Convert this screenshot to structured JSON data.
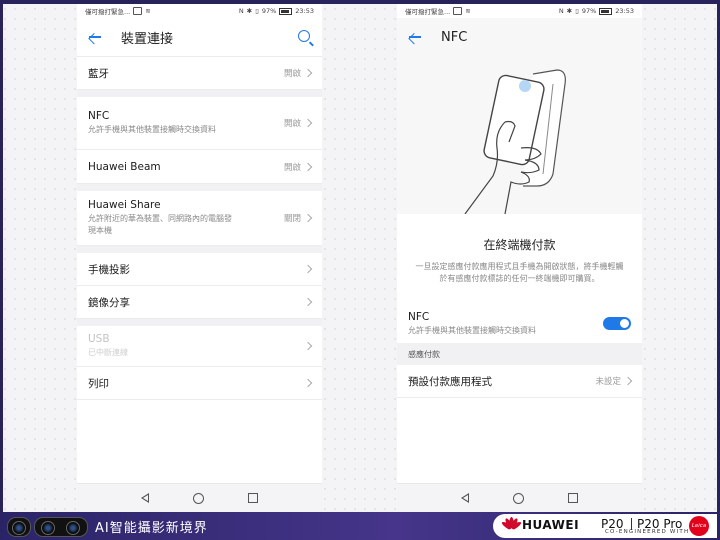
{
  "left_phone": {
    "status": {
      "carrier": "僅可撥打緊急...",
      "battery": "97%",
      "time": "23:53"
    },
    "title": "裝置連接",
    "items": [
      {
        "label": "藍牙",
        "sub": "",
        "value": "開啟"
      },
      {
        "label": "NFC",
        "sub": "允許手機與其他裝置接觸時交換資料",
        "value": "開啟"
      },
      {
        "label": "Huawei Beam",
        "sub": "",
        "value": "開啟"
      },
      {
        "label": "Huawei Share",
        "sub": "允許附近的華為裝置、同網路內的電腦發現本機",
        "value": "關閉"
      },
      {
        "label": "手機投影",
        "sub": "",
        "value": ""
      },
      {
        "label": "鏡像分享",
        "sub": "",
        "value": ""
      },
      {
        "label": "USB",
        "sub": "已中斷連線",
        "value": ""
      },
      {
        "label": "列印",
        "sub": "",
        "value": ""
      }
    ]
  },
  "right_phone": {
    "status": {
      "carrier": "僅可撥打緊急...",
      "battery": "97%",
      "time": "23:53"
    },
    "title": "NFC",
    "heading": "在終端機付款",
    "description": "一旦設定感應付款應用程式且手機為開啟狀態，將手機輕觸於有感應付款標誌的任何一終端機即可購買。",
    "nfc_label": "NFC",
    "nfc_sub": "允許手機與其他裝置接觸時交換資料",
    "nfc_enabled": true,
    "section": "感應付款",
    "default_app_label": "預設付款應用程式",
    "default_app_value": "未設定"
  },
  "banner": {
    "slogan": "AI智能攝影新境界",
    "brand": "HUAWEI",
    "model1": "P20",
    "model2": "P20 Pro",
    "tagline": "CO-ENGINEERED WITH",
    "leica": "Leica"
  },
  "colors": {
    "accent": "#1f7ae8",
    "banner": "#3b2f7a",
    "brand_red": "#cf0a2c"
  }
}
